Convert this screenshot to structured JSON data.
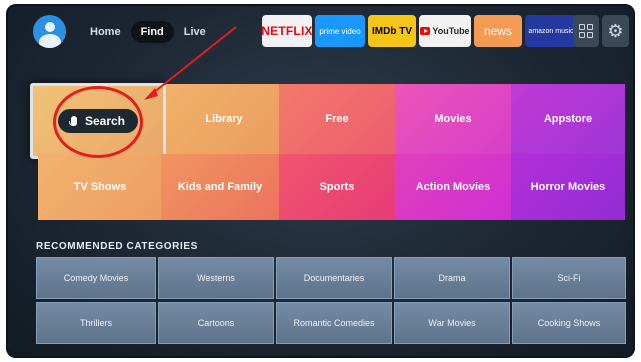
{
  "nav": {
    "home": "Home",
    "find": "Find",
    "live": "Live"
  },
  "apps": {
    "netflix": "NETFLIX",
    "prime": "prime video",
    "imdb": "IMDb TV",
    "youtube": "YouTube",
    "news": "news",
    "amazon_music": "amazon music"
  },
  "icons": {
    "settings_glyph": "⚙"
  },
  "tiles": {
    "search": "Search",
    "library": "Library",
    "free": "Free",
    "movies": "Movies",
    "appstore": "Appstore",
    "tv_shows": "TV Shows",
    "kids_and_family": "Kids and Family",
    "sports": "Sports",
    "action_movies": "Action Movies",
    "horror_movies": "Horror Movies"
  },
  "recommended": {
    "title": "RECOMMENDED CATEGORIES",
    "items": [
      "Comedy Movies",
      "Westerns",
      "Documentaries",
      "Drama",
      "Sci-Fi",
      "Thrillers",
      "Cartoons",
      "Romantic Comedies",
      "War Movies",
      "Cooking Shows"
    ]
  },
  "colors": {
    "annotation": "#e41d1d",
    "accent": "#2a90e6"
  }
}
